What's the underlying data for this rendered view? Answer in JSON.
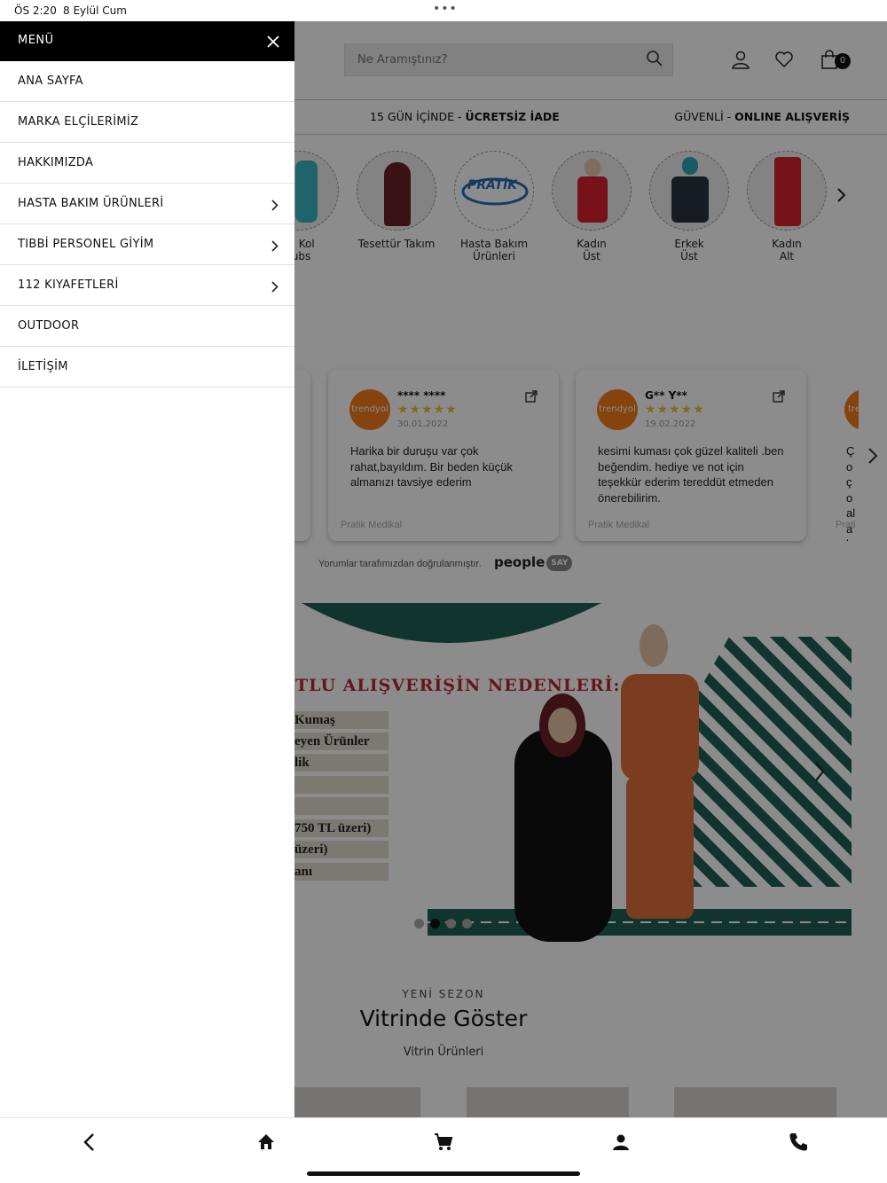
{
  "status": {
    "time": "ÖS 2:20",
    "date": "8 Eylül Cum",
    "dots": "•••"
  },
  "header": {
    "search_placeholder": "Ne Aramıştınız?",
    "cart_count": "0"
  },
  "infobar": {
    "left_prefix": "15 GÜN İÇİNDE - ",
    "left_bold": "ÜCRETSİZ İADE",
    "right_prefix": "GÜVENLİ - ",
    "right_bold": "ONLINE ALIŞVERİŞ"
  },
  "categories": [
    {
      "line1": "sa Kol",
      "line2": "rubs"
    },
    {
      "line1": "Tesettür Takım",
      "line2": ""
    },
    {
      "line1": "Hasta Bakım",
      "line2": "Ürünleri"
    },
    {
      "line1": "Kadın",
      "line2": "Üst"
    },
    {
      "line1": "Erkek",
      "line2": "Üst"
    },
    {
      "line1": "Kadın",
      "line2": "Alt"
    }
  ],
  "reviews": [
    {
      "logo": "trendyol",
      "name": "**** ****",
      "stars": "★★★★★",
      "date": "30.01.2022",
      "text": "Harika bir duruşu var çok rahat,bayıldım. Bir beden küçük almanızı tavsiye ederim",
      "footer": "Pratik Medikal"
    },
    {
      "logo": "trendyol",
      "name": "G** Y**",
      "stars": "★★★★★",
      "date": "19.02.2022",
      "text": "kesimi kuması çok güzel kaliteli .ben beğendim. hediye ve not için teşekkür ederim tereddüt etmeden önerebilirim.",
      "footer": "Pratik Medikal"
    },
    {
      "logo": "tre",
      "text": "Ço ço ala bo",
      "footer": "Prati"
    }
  ],
  "verified_text": "Yorumlar tarafımızdan doğrulanmıştır.",
  "peoplesay": {
    "brand": "people",
    "badge": "SAY"
  },
  "banner": {
    "heading": "TLU ALIŞVERİŞİN NEDENLERİ:",
    "rows": [
      "Kumaş",
      "eyen Ürünler",
      "lik",
      "",
      "",
      "750 TL üzeri)",
      "üzeri)",
      "anı"
    ],
    "active_slide": 2,
    "slide_count": 4
  },
  "showcase": {
    "subtitle": "YENİ SEZON",
    "title": "Vitrinde Göster",
    "link": "Vitrin Ürünleri"
  },
  "menu": {
    "title": "MENÜ",
    "items": [
      {
        "label": "ANA SAYFA",
        "has_children": false
      },
      {
        "label": "MARKA ELÇİLERİMİZ",
        "has_children": false
      },
      {
        "label": "HAKKIMIZDA",
        "has_children": false
      },
      {
        "label": "HASTA BAKIM ÜRÜNLERİ",
        "has_children": true
      },
      {
        "label": "TIBBİ PERSONEL GİYİM",
        "has_children": true
      },
      {
        "label": "112 KIYAFETLERİ",
        "has_children": true
      },
      {
        "label": "OUTDOOR",
        "has_children": false
      },
      {
        "label": "İLETİŞİM",
        "has_children": false
      }
    ]
  },
  "tabbar": [
    "back-icon",
    "home-icon",
    "cart-icon",
    "user-icon",
    "phone-icon"
  ],
  "colors": {
    "accent_red": "#b8282e",
    "teal": "#1f5f55",
    "trendyol": "#f27a1a",
    "star": "#e8c23a"
  }
}
